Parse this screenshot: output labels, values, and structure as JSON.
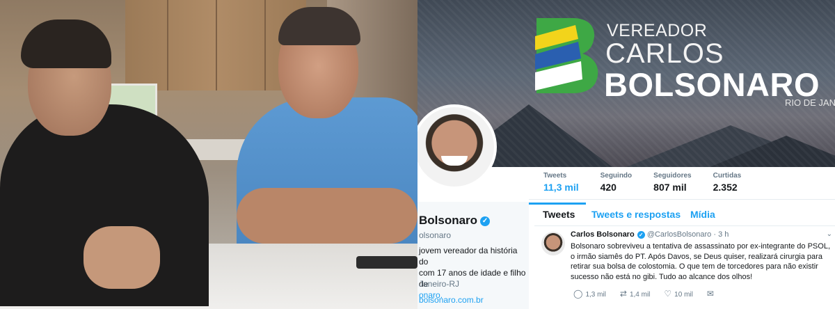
{
  "banner": {
    "line1": "VEREADOR",
    "line2": "CARLOS",
    "line3": "BOLSONARO",
    "line4": "RIO DE JANEIRO / R",
    "logo_colors": {
      "green": "#3ea845",
      "yellow": "#f2d41b",
      "blue": "#2a5fb0",
      "white": "#ffffff"
    }
  },
  "stats": [
    {
      "label": "Tweets",
      "value": "11,3 mil"
    },
    {
      "label": "Seguindo",
      "value": "420"
    },
    {
      "label": "Seguidores",
      "value": "807 mil"
    },
    {
      "label": "Curtidas",
      "value": "2.352"
    }
  ],
  "profile": {
    "name": "Bolsonaro",
    "handle": "olsonaro",
    "bio_line1": "jovem vereador da história do",
    "bio_line2": "com 17 anos de idade e filho de",
    "bio_line3": "onaro.",
    "location": "Janeiro-RJ",
    "url": "bolsonaro.com.br"
  },
  "tabs": [
    "Tweets",
    "Tweets e respostas",
    "Mídia"
  ],
  "tweet": {
    "author": "Carlos Bolsonaro",
    "handle": "@CarlosBolsonaro",
    "time": "· 3 h",
    "text": "Bolsonaro sobreviveu a tentativa de assassinato por ex-integrante do PSOL, o irmão siamês do PT. Após Davos, se Deus quiser, realizará cirurgia para retirar sua bolsa de colostomia. O que tem de torcedores para não existir sucesso não está no gibi. Tudo ao alcance dos olhos!",
    "replies": "1,3 mil",
    "retweets": "1,4 mil",
    "likes": "10 mil"
  },
  "colors": {
    "twitter_blue": "#1da1f2",
    "text_dark": "#14171a",
    "text_gray": "#657786"
  }
}
